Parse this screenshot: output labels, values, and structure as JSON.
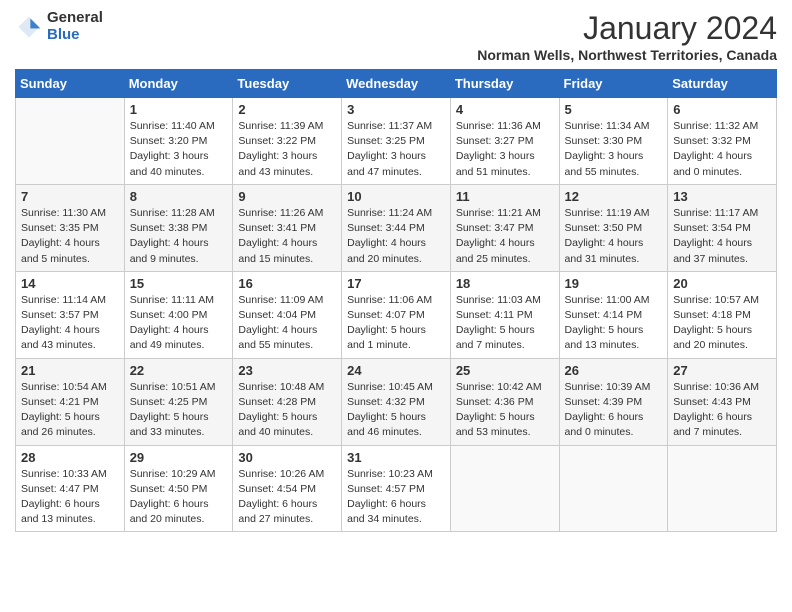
{
  "header": {
    "logo_general": "General",
    "logo_blue": "Blue",
    "month_title": "January 2024",
    "subtitle": "Norman Wells, Northwest Territories, Canada"
  },
  "weekdays": [
    "Sunday",
    "Monday",
    "Tuesday",
    "Wednesday",
    "Thursday",
    "Friday",
    "Saturday"
  ],
  "weeks": [
    [
      {
        "day": "",
        "info": ""
      },
      {
        "day": "1",
        "info": "Sunrise: 11:40 AM\nSunset: 3:20 PM\nDaylight: 3 hours\nand 40 minutes."
      },
      {
        "day": "2",
        "info": "Sunrise: 11:39 AM\nSunset: 3:22 PM\nDaylight: 3 hours\nand 43 minutes."
      },
      {
        "day": "3",
        "info": "Sunrise: 11:37 AM\nSunset: 3:25 PM\nDaylight: 3 hours\nand 47 minutes."
      },
      {
        "day": "4",
        "info": "Sunrise: 11:36 AM\nSunset: 3:27 PM\nDaylight: 3 hours\nand 51 minutes."
      },
      {
        "day": "5",
        "info": "Sunrise: 11:34 AM\nSunset: 3:30 PM\nDaylight: 3 hours\nand 55 minutes."
      },
      {
        "day": "6",
        "info": "Sunrise: 11:32 AM\nSunset: 3:32 PM\nDaylight: 4 hours\nand 0 minutes."
      }
    ],
    [
      {
        "day": "7",
        "info": "Sunrise: 11:30 AM\nSunset: 3:35 PM\nDaylight: 4 hours\nand 5 minutes."
      },
      {
        "day": "8",
        "info": "Sunrise: 11:28 AM\nSunset: 3:38 PM\nDaylight: 4 hours\nand 9 minutes."
      },
      {
        "day": "9",
        "info": "Sunrise: 11:26 AM\nSunset: 3:41 PM\nDaylight: 4 hours\nand 15 minutes."
      },
      {
        "day": "10",
        "info": "Sunrise: 11:24 AM\nSunset: 3:44 PM\nDaylight: 4 hours\nand 20 minutes."
      },
      {
        "day": "11",
        "info": "Sunrise: 11:21 AM\nSunset: 3:47 PM\nDaylight: 4 hours\nand 25 minutes."
      },
      {
        "day": "12",
        "info": "Sunrise: 11:19 AM\nSunset: 3:50 PM\nDaylight: 4 hours\nand 31 minutes."
      },
      {
        "day": "13",
        "info": "Sunrise: 11:17 AM\nSunset: 3:54 PM\nDaylight: 4 hours\nand 37 minutes."
      }
    ],
    [
      {
        "day": "14",
        "info": "Sunrise: 11:14 AM\nSunset: 3:57 PM\nDaylight: 4 hours\nand 43 minutes."
      },
      {
        "day": "15",
        "info": "Sunrise: 11:11 AM\nSunset: 4:00 PM\nDaylight: 4 hours\nand 49 minutes."
      },
      {
        "day": "16",
        "info": "Sunrise: 11:09 AM\nSunset: 4:04 PM\nDaylight: 4 hours\nand 55 minutes."
      },
      {
        "day": "17",
        "info": "Sunrise: 11:06 AM\nSunset: 4:07 PM\nDaylight: 5 hours\nand 1 minute."
      },
      {
        "day": "18",
        "info": "Sunrise: 11:03 AM\nSunset: 4:11 PM\nDaylight: 5 hours\nand 7 minutes."
      },
      {
        "day": "19",
        "info": "Sunrise: 11:00 AM\nSunset: 4:14 PM\nDaylight: 5 hours\nand 13 minutes."
      },
      {
        "day": "20",
        "info": "Sunrise: 10:57 AM\nSunset: 4:18 PM\nDaylight: 5 hours\nand 20 minutes."
      }
    ],
    [
      {
        "day": "21",
        "info": "Sunrise: 10:54 AM\nSunset: 4:21 PM\nDaylight: 5 hours\nand 26 minutes."
      },
      {
        "day": "22",
        "info": "Sunrise: 10:51 AM\nSunset: 4:25 PM\nDaylight: 5 hours\nand 33 minutes."
      },
      {
        "day": "23",
        "info": "Sunrise: 10:48 AM\nSunset: 4:28 PM\nDaylight: 5 hours\nand 40 minutes."
      },
      {
        "day": "24",
        "info": "Sunrise: 10:45 AM\nSunset: 4:32 PM\nDaylight: 5 hours\nand 46 minutes."
      },
      {
        "day": "25",
        "info": "Sunrise: 10:42 AM\nSunset: 4:36 PM\nDaylight: 5 hours\nand 53 minutes."
      },
      {
        "day": "26",
        "info": "Sunrise: 10:39 AM\nSunset: 4:39 PM\nDaylight: 6 hours\nand 0 minutes."
      },
      {
        "day": "27",
        "info": "Sunrise: 10:36 AM\nSunset: 4:43 PM\nDaylight: 6 hours\nand 7 minutes."
      }
    ],
    [
      {
        "day": "28",
        "info": "Sunrise: 10:33 AM\nSunset: 4:47 PM\nDaylight: 6 hours\nand 13 minutes."
      },
      {
        "day": "29",
        "info": "Sunrise: 10:29 AM\nSunset: 4:50 PM\nDaylight: 6 hours\nand 20 minutes."
      },
      {
        "day": "30",
        "info": "Sunrise: 10:26 AM\nSunset: 4:54 PM\nDaylight: 6 hours\nand 27 minutes."
      },
      {
        "day": "31",
        "info": "Sunrise: 10:23 AM\nSunset: 4:57 PM\nDaylight: 6 hours\nand 34 minutes."
      },
      {
        "day": "",
        "info": ""
      },
      {
        "day": "",
        "info": ""
      },
      {
        "day": "",
        "info": ""
      }
    ]
  ]
}
